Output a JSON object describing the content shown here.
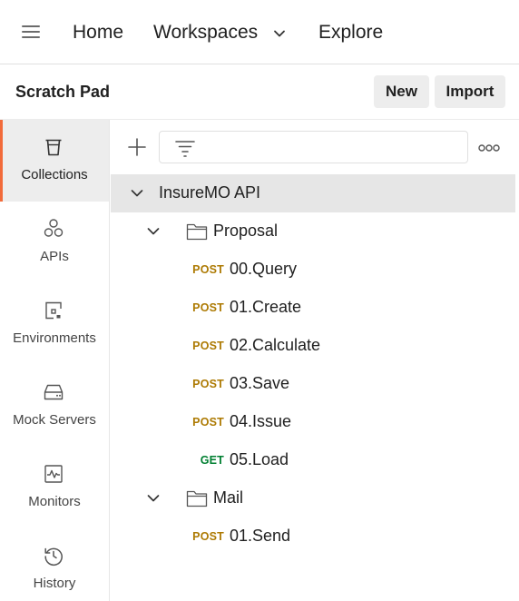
{
  "topnav": {
    "menu_icon": "hamburger-icon",
    "home": "Home",
    "workspaces": "Workspaces",
    "workspaces_icon": "chevron-down-icon",
    "explore": "Explore"
  },
  "scratchpad": {
    "title": "Scratch Pad",
    "new_label": "New",
    "import_label": "Import"
  },
  "rail": {
    "items": [
      {
        "label": "Collections",
        "icon": "trash-can-icon",
        "active": true
      },
      {
        "label": "APIs",
        "icon": "apis-icon",
        "active": false
      },
      {
        "label": "Environments",
        "icon": "environment-icon",
        "active": false
      },
      {
        "label": "Mock Servers",
        "icon": "server-icon",
        "active": false
      },
      {
        "label": "Monitors",
        "icon": "monitor-icon",
        "active": false
      },
      {
        "label": "History",
        "icon": "history-icon",
        "active": false
      }
    ]
  },
  "toolbar": {
    "add_icon": "plus-icon",
    "filter_icon": "filter-icon",
    "more_icon": "more-options-icon"
  },
  "tree": {
    "collection": {
      "name": "InsureMO API",
      "expanded": true
    },
    "folders": [
      {
        "name": "Proposal",
        "expanded": true,
        "requests": [
          {
            "method": "POST",
            "name": "00.Query"
          },
          {
            "method": "POST",
            "name": "01.Create"
          },
          {
            "method": "POST",
            "name": "02.Calculate"
          },
          {
            "method": "POST",
            "name": "03.Save"
          },
          {
            "method": "POST",
            "name": "04.Issue"
          },
          {
            "method": "GET",
            "name": "05.Load"
          }
        ]
      },
      {
        "name": "Mail",
        "expanded": true,
        "requests": [
          {
            "method": "POST",
            "name": "01.Send"
          }
        ]
      }
    ]
  },
  "colors": {
    "accent": "#f26b3a",
    "post": "#ad7a03",
    "get": "#007f31",
    "selected_bg": "#e6e6e6"
  }
}
